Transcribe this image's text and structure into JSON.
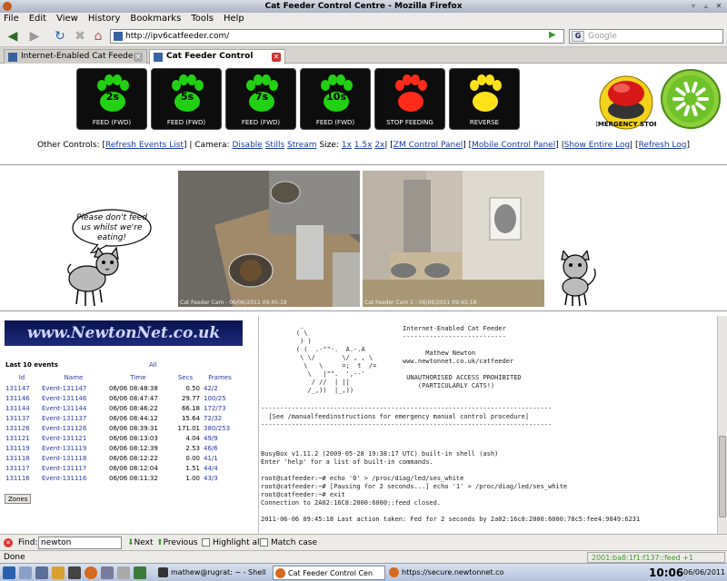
{
  "window": {
    "title": "Cat Feeder Control Centre - Mozilla Firefox"
  },
  "menu": [
    "File",
    "Edit",
    "View",
    "History",
    "Bookmarks",
    "Tools",
    "Help"
  ],
  "nav": {
    "url": "http://ipv6catfeeder.com/",
    "search_placeholder": "Google",
    "search_engine_icon": "G"
  },
  "tabs": [
    {
      "label": "Internet-Enabled Cat Feeder",
      "active": false
    },
    {
      "label": "Cat Feeder Control Centre",
      "active": true
    }
  ],
  "controls": {
    "buttons": [
      {
        "seconds": "2s",
        "label": "FEED (FWD)",
        "color": "#22d014"
      },
      {
        "seconds": "5s",
        "label": "FEED (FWD)",
        "color": "#22d014"
      },
      {
        "seconds": "7s",
        "label": "FEED (FWD)",
        "color": "#22d014"
      },
      {
        "seconds": "10s",
        "label": "FEED (FWD)",
        "color": "#22d014"
      },
      {
        "seconds": "",
        "label": "STOP FEEDING",
        "color": "#ff2a1a"
      },
      {
        "seconds": "",
        "label": "REVERSE",
        "color": "#ffe21a"
      }
    ],
    "emergency_label": "EMERGENCY STOP",
    "other_controls": {
      "prefix": "Other Controls:",
      "refresh_events": "Refresh Events List",
      "camera_prefix": "| Camera:",
      "disable": "Disable",
      "stills": "Stills",
      "stream": "Stream",
      "size_prefix": "Size:",
      "size_1x": "1x",
      "size_15x": "1.5x",
      "size_2x": "2x",
      "zm_panel": "ZM Control Panel",
      "mobile_panel": "Mobile Control Panel",
      "show_log": "Show Entire Log",
      "refresh_log": "Refresh Log"
    }
  },
  "bubble_text": "Please don't feed us whilst we're eating!",
  "cameras": [
    {
      "timestamp": "Cat Feeder Cam - 06/06/2011 09:45:18"
    },
    {
      "timestamp": "Cat Feeder Cam 2 - 06/06/2011 09:45:18"
    }
  ],
  "logo_text": "www.NewtonNet.co.uk",
  "events": {
    "title": "Last 10 events",
    "all_link": "All",
    "headers": [
      "Id",
      "Name",
      "Time",
      "Secs",
      "Frames"
    ],
    "rows": [
      [
        "131147",
        "Event-131147",
        "06/06 08:48:38",
        "0.50",
        "42/2"
      ],
      [
        "131146",
        "Event-131146",
        "06/06 08:47:47",
        "29.77",
        "100/25"
      ],
      [
        "131144",
        "Event-131144",
        "06/06 08:46:22",
        "66.18",
        "172/73"
      ],
      [
        "131137",
        "Event-131137",
        "06/06 08:44:12",
        "15.64",
        "72/32"
      ],
      [
        "131126",
        "Event-131126",
        "06/06 08:39:31",
        "171.01",
        "380/253"
      ],
      [
        "131121",
        "Event-131121",
        "06/06 08:13:03",
        "4.04",
        "49/9"
      ],
      [
        "131119",
        "Event-131119",
        "06/06 08:12:39",
        "2.53",
        "46/6"
      ],
      [
        "131118",
        "Event-131118",
        "06/06 08:12:22",
        "0.00",
        "41/1"
      ],
      [
        "131117",
        "Event-131117",
        "06/06 08:12:04",
        "1.51",
        "44/4"
      ],
      [
        "131116",
        "Event-131116",
        "06/06 08:11:32",
        "1.00",
        "43/3"
      ]
    ],
    "zones_button": "Zones"
  },
  "terminal": {
    "ascii_cat": "     _\n    ( \\\n     ) )\n    ( (  .-\"\"-.  A.-.A\n     \\ \\/       \\/ , , \\\n      \\   \\     =;  t  /=\n       \\   |\"\".  ',--'\n        / //  | ||\n       /_,))  |_,))",
    "header_text": "Internet-Enabled Cat Feeder\n---------------------------\n\n      Mathew Newton\nwww.newtonnet.co.uk/catfeeder\n\n UNAUTHORISED ACCESS PROHIBITED\n    (PARTICULARLY CATS!)",
    "banner": "----------------------------------------------------------------------------\n  [See /manualfeedinstructions for emergency manual control procedure]\n----------------------------------------------------------------------------",
    "session": "BusyBox v1.11.2 (2009-05-28 19:38:17 UTC) built-in shell (ash)\nEnter 'help' for a list of built-in commands.\n\nroot@catfeeder:~# echo '0' > /proc/diag/led/ses_white\nroot@catfeeder:~# [Pausing for 2 seconds...] echo '1' > /proc/diag/led/ses_white\nroot@catfeeder:~# exit\nConnection to 2A02:16C8:2000:6000::feed closed.\n\n2011-06-06 09:45:18 Last action taken: Fed for 2 seconds by 2a02:16c8:2000:6000:78c5:fee4:9849:6231"
  },
  "findbar": {
    "label": "Find:",
    "value": "newton",
    "next": "Next",
    "previous": "Previous",
    "highlight": "Highlight all",
    "match_case": "Match case"
  },
  "status": {
    "text": "Done",
    "ipv6": "2001:ba8:1f1:f137::feed +1"
  },
  "taskbar": {
    "tasks": [
      {
        "label": "mathew@rugrat: ~ - Shell",
        "active": false
      },
      {
        "label": "Cat Feeder Control Cen",
        "active": true
      },
      {
        "label": "https://secure.newtonnet.co",
        "active": false
      }
    ],
    "clock": "10:06",
    "date": "06/06/2011"
  }
}
